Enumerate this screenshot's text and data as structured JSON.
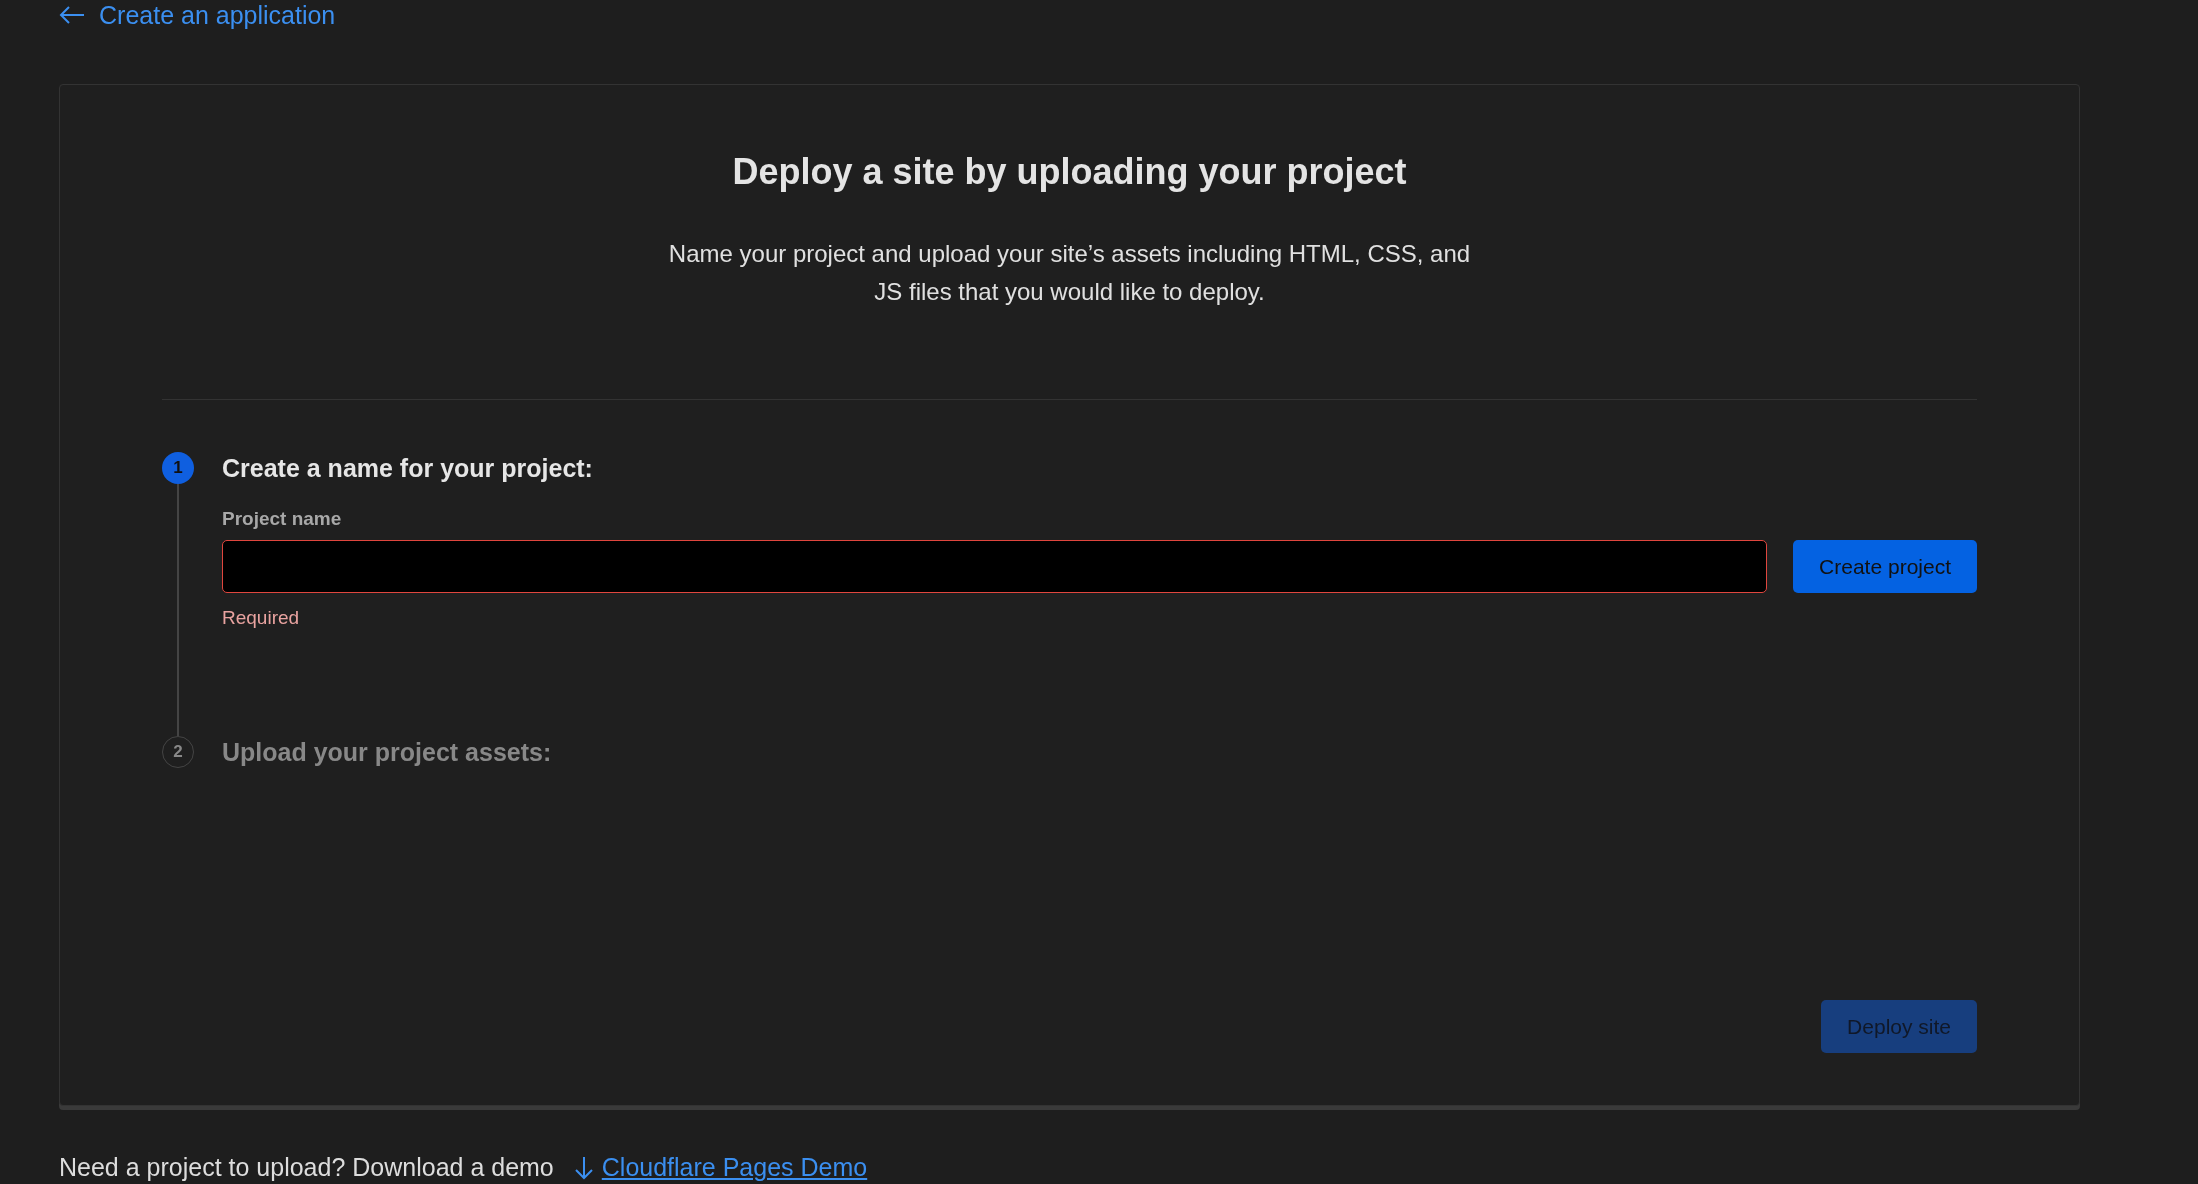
{
  "back_link": {
    "label": "Create an application"
  },
  "card": {
    "title": "Deploy a site by uploading your project",
    "description": "Name your project and upload your site’s assets including HTML, CSS, and JS files that you would like to deploy."
  },
  "steps": [
    {
      "number": "1",
      "title": "Create a name for your project:",
      "active": true
    },
    {
      "number": "2",
      "title": "Upload your project assets:",
      "active": false
    }
  ],
  "project_name": {
    "label": "Project name",
    "error": "Required",
    "invalid": true
  },
  "create_button": {
    "label": "Create project",
    "disabled": false
  },
  "deploy_button": {
    "label": "Deploy site",
    "disabled": true
  },
  "footer": {
    "text": "Need a project to upload? Download a demo",
    "link": "Cloudflare Pages Demo"
  }
}
